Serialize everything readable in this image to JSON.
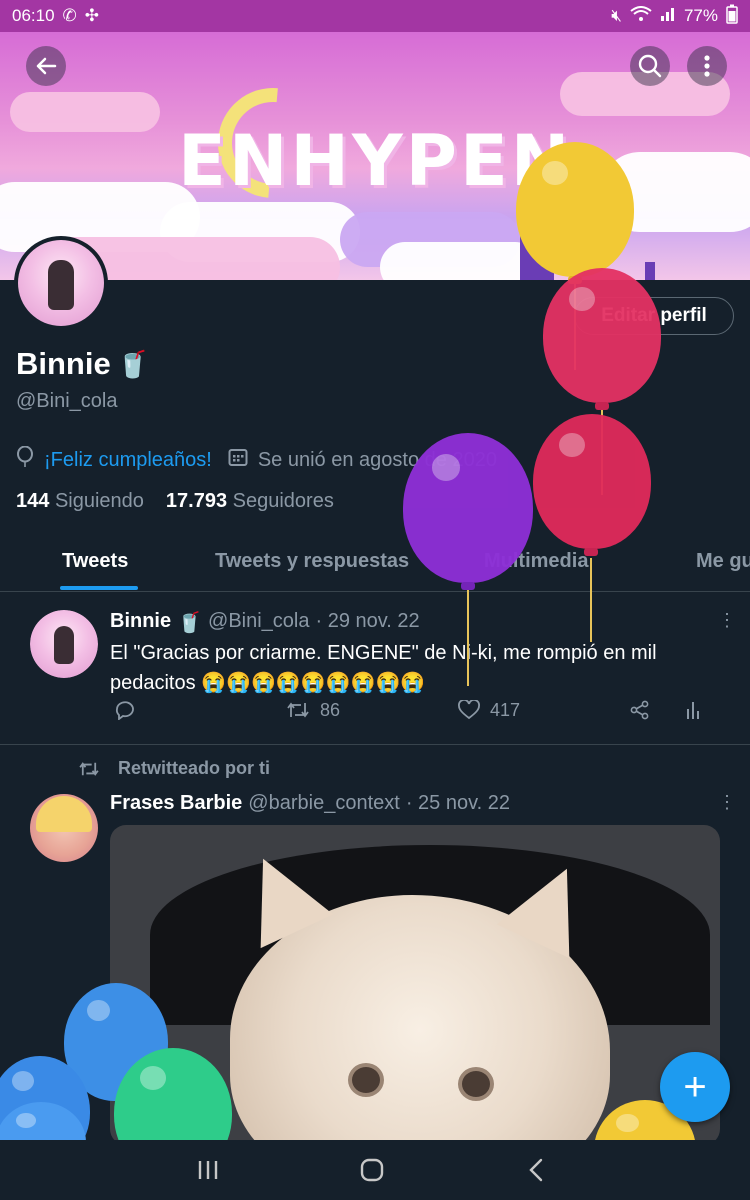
{
  "status_bar": {
    "time": "06:10",
    "battery": "77%"
  },
  "banner": {
    "title": "ENHYPEN"
  },
  "profile": {
    "edit_label": "Editar perfil",
    "name": "Binnie",
    "handle": "@Bini_cola",
    "birthday": "¡Feliz cumpleaños!",
    "joined": "Se unió en agosto de 2020",
    "following_count": "144",
    "following_label": "Siguiendo",
    "followers_count": "17.793",
    "followers_label": "Seguidores"
  },
  "tabs": [
    {
      "label": "Tweets"
    },
    {
      "label": "Tweets y respuestas"
    },
    {
      "label": "Multimedia"
    },
    {
      "label": "Me gusta"
    }
  ],
  "tweets": [
    {
      "author": "Binnie",
      "handle": "@Bini_cola",
      "date": "· 29 nov. 22",
      "text": "El \"Gracias por criarme. ENGENE\" de Ni-ki, me rompió en mil pedacitos 😭😭😭😭😭😭😭😭😭",
      "retweets": "86",
      "likes": "417"
    },
    {
      "retweet_note": "Retwitteado por ti",
      "author": "Frases Barbie",
      "handle": "@barbie_context",
      "date": "· 25 nov. 22"
    }
  ],
  "icons": {
    "back": "back-arrow-icon",
    "search": "search-icon",
    "more": "more-vertical-icon",
    "fab": "compose-plus-icon"
  },
  "colors": {
    "accent": "#1d9bf0",
    "background": "#15202b",
    "status_bar": "#a336a3"
  }
}
